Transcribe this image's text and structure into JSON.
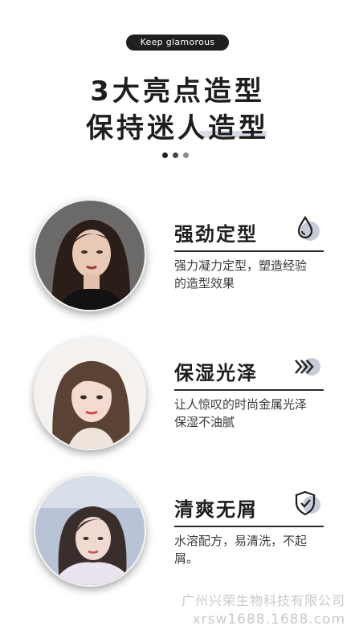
{
  "header": {
    "tag": "Keep glamorous",
    "headline_1": "3大亮点造型",
    "headline_2": "保持迷人造型"
  },
  "features": [
    {
      "title": "强劲定型",
      "icon": "water-drop-icon",
      "desc_1": "强力凝力定型，塑造经验",
      "desc_2": "的造型效果"
    },
    {
      "title": "保湿光泽",
      "icon": "fast-forward-chevrons-icon",
      "desc_1": "让人惊叹的时尚金属光泽",
      "desc_2": "保湿不油腻"
    },
    {
      "title": "清爽无屑",
      "icon": "shield-check-icon",
      "desc_1": "水溶配方，易清洗，不起",
      "desc_2": "屑。"
    }
  ],
  "watermark": {
    "company": "广州兴荣生物科技有限公司",
    "website": "xrsw1688.1688.com"
  },
  "colors": {
    "text": "#1e1e1e",
    "icon_accent": "#c7cad8",
    "watermark": "#c9c9c9"
  }
}
